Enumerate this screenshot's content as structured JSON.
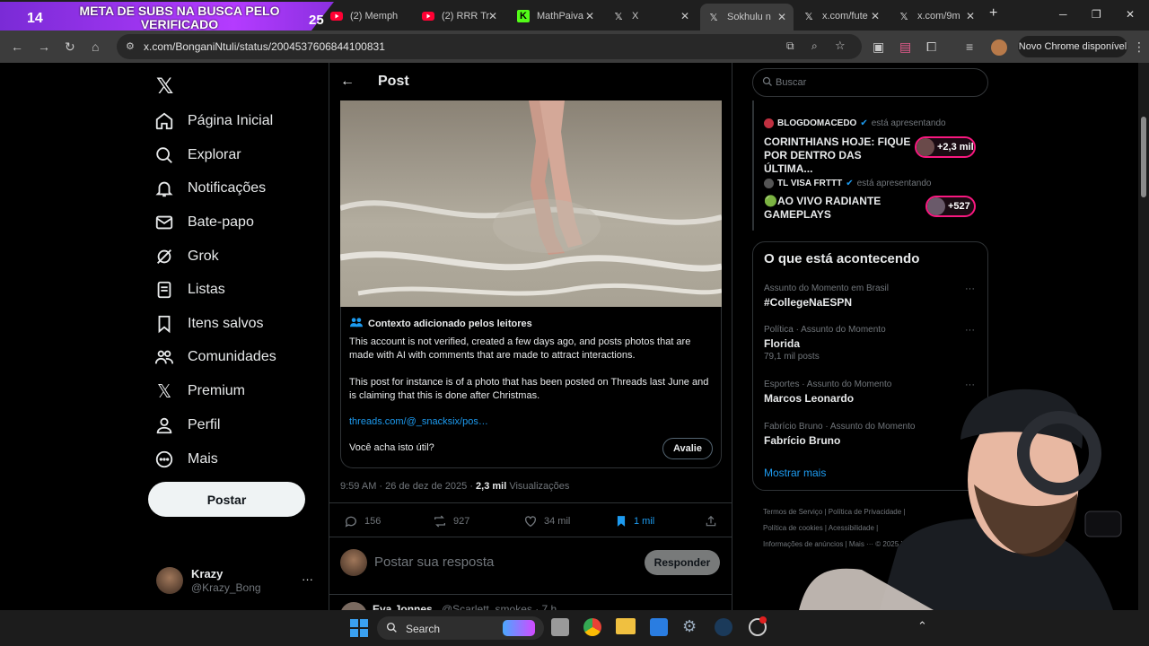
{
  "overlay": {
    "left_count": "14",
    "banner_text": "META DE SUBS NA BUSCA PELO VERIFICADO",
    "right_count": "25"
  },
  "browser": {
    "tabs": [
      {
        "label": "(2) Memph",
        "icon": "youtube-icon"
      },
      {
        "label": "(2) RRR Tr",
        "icon": "youtube-icon"
      },
      {
        "label": "MathPaiva",
        "icon": "kick-icon"
      },
      {
        "label": "X",
        "icon": "x-logo-icon"
      },
      {
        "label": "Sokhulu n",
        "icon": "x-logo-icon",
        "active": true
      },
      {
        "label": "x.com/fute",
        "icon": "x-logo-icon"
      },
      {
        "label": "x.com/9m",
        "icon": "x-logo-icon"
      }
    ],
    "url": "x.com/BonganiNtuli/status/2004537606844100831",
    "update_button": "Novo Chrome disponível"
  },
  "sidebar": {
    "items": [
      {
        "label": "Página Inicial",
        "icon": "home-icon"
      },
      {
        "label": "Explorar",
        "icon": "search-icon"
      },
      {
        "label": "Notificações",
        "icon": "bell-icon"
      },
      {
        "label": "Bate-papo",
        "icon": "mail-icon"
      },
      {
        "label": "Grok",
        "icon": "grok-icon"
      },
      {
        "label": "Listas",
        "icon": "list-icon"
      },
      {
        "label": "Itens salvos",
        "icon": "bookmark-icon"
      },
      {
        "label": "Comunidades",
        "icon": "people-icon"
      },
      {
        "label": "Premium",
        "icon": "x-logo-icon"
      },
      {
        "label": "Perfil",
        "icon": "person-icon"
      },
      {
        "label": "Mais",
        "icon": "more-circle-icon"
      }
    ],
    "post_button": "Postar",
    "account": {
      "name": "Krazy",
      "handle": "@Krazy_Bong"
    }
  },
  "post": {
    "header_title": "Post",
    "note": {
      "title": "Contexto adicionado pelos leitores",
      "paragraph1": "This account is not verified, created a few days ago, and posts photos that are made with AI with comments that are made to attract interactions.",
      "paragraph2": "This post for instance is of a photo that has been posted on Threads last June and is claiming that this is done after Christmas.",
      "link": "threads.com/@_snacksix/pos…",
      "question": "Você acha isto útil?",
      "rate_button": "Avalie"
    },
    "timestamp": "9:59 AM · 26 de dez de 2025 · ",
    "views_count": "2,3 mil",
    "views_label": " Visualizações",
    "stats": {
      "replies": "156",
      "reposts": "927",
      "likes": "34 mil",
      "bookmarks": "1 mil"
    },
    "reply_placeholder": "Postar sua resposta",
    "reply_button": "Responder",
    "next_reply": {
      "name": "Eva Jonnes",
      "handle": "@Scarlett_smokes · 7 h"
    }
  },
  "right": {
    "search_placeholder": "Buscar",
    "live": [
      {
        "host": "BLOGDOMACEDO",
        "status": "está apresentando",
        "title": "CORINTHIANS HOJE: FIQUE POR DENTRO DAS ÚLTIMA...",
        "count": "+2,3 mil"
      },
      {
        "host": "TL VISA FRTTT",
        "status": "está apresentando",
        "title": "🟢AO VIVO RADIANTE GAMEPLAYS",
        "count": "+527"
      }
    ],
    "trends_title": "O que está acontecendo",
    "trends": [
      {
        "context": "Assunto do Momento em Brasil",
        "name": "#CollegeNaESPN",
        "count": ""
      },
      {
        "context": "Política · Assunto do Momento",
        "name": "Florida",
        "count": "79,1 mil posts"
      },
      {
        "context": "Esportes · Assunto do Momento",
        "name": "Marcos Leonardo",
        "count": ""
      },
      {
        "context": "Fabrício Bruno · Assunto do Momento",
        "name": "Fabrício Bruno",
        "count": ""
      }
    ],
    "show_more": "Mostrar mais",
    "footer": [
      "Termos de Serviço",
      "Política de Privacidade",
      "Política de cookies",
      "Acessibilidade",
      "Informações de anúncios",
      "Mais ···",
      "© 2025 X C"
    ]
  },
  "taskbar": {
    "search_label": "Search"
  },
  "colors": {
    "accent": "#1d9bf0",
    "brand_pink": "#f91880",
    "banner": "#a838f5"
  }
}
